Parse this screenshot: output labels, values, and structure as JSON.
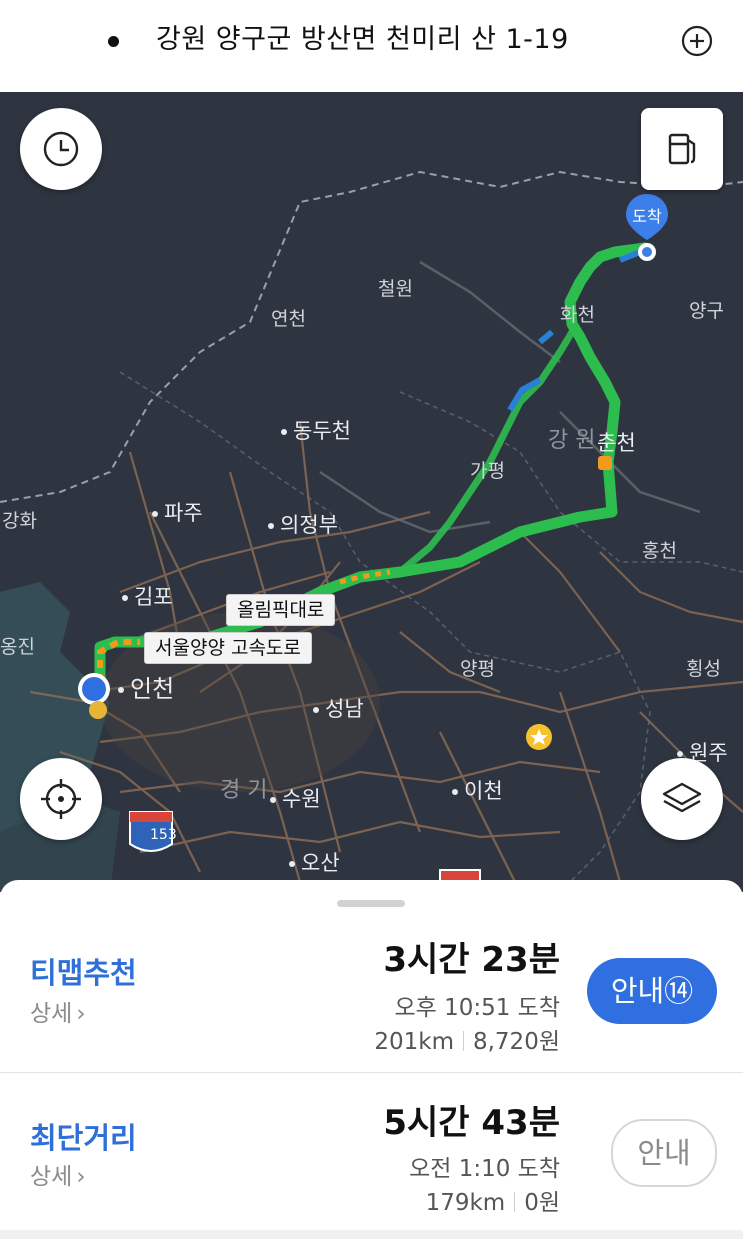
{
  "header": {
    "address": "강원 양구군 방산면 천미리 산 1-19"
  },
  "map": {
    "labels": {
      "cheorwon": "철원",
      "yeoncheon": "연천",
      "hwacheon": "화천",
      "yanggu": "양구",
      "dongducheon": "동두천",
      "gangwon": "강 원",
      "chuncheon": "춘천",
      "gapyeong": "가평",
      "paju": "파주",
      "uijeongbu": "의정부",
      "ganghwa": "강화",
      "gimpo": "김포",
      "hongcheon": "홍천",
      "incheon": "인천",
      "yangpyeong": "양평",
      "hoengseong": "횡성",
      "seongnam": "성남",
      "wonju": "원주",
      "gyeonggi": "경 기",
      "suwon": "수원",
      "icheon": "이천",
      "osan": "오산",
      "ongjin": "옹진"
    },
    "road_tags": {
      "olympic": "올림픽대로",
      "expressway": "서울양양 고속도로"
    },
    "destination_marker": "도착",
    "highway_shield": "153",
    "icons": [
      "history-icon",
      "gas-station-icon",
      "add-icon",
      "locate-icon",
      "layers-icon"
    ],
    "colors": {
      "route": "#2dbd4f",
      "traffic_slow": "#f29a1d",
      "traffic_fast": "#2a7fd6",
      "start": "#2f6fe0",
      "map_bg": "#2f3540"
    }
  },
  "routes": [
    {
      "name": "티맵추천",
      "detail": "상세",
      "duration": "3시간 23분",
      "arrival": "오후 10:51 도착",
      "distance": "201km",
      "toll": "8,720원",
      "button": "안내⑭",
      "primary": true
    },
    {
      "name": "최단거리",
      "detail": "상세",
      "duration": "5시간 43분",
      "arrival": "오전 1:10 도착",
      "distance": "179km",
      "toll": "0원",
      "button": "안내",
      "primary": false
    }
  ]
}
